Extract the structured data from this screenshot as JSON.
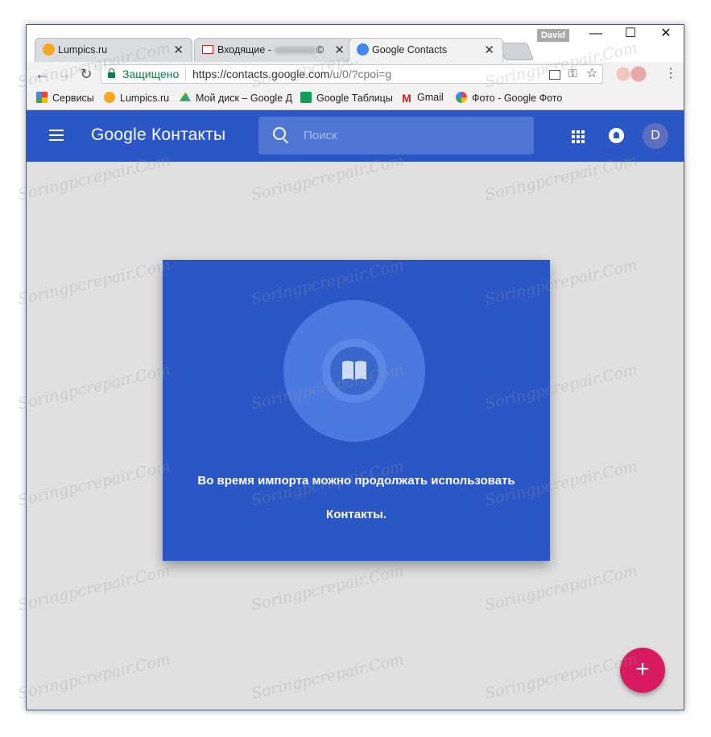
{
  "browser": {
    "profile_name": "David",
    "tabs": [
      {
        "title": "Lumpics.ru",
        "favicon": "orange-icon"
      },
      {
        "title": "Входящие -",
        "suffix": "©",
        "favicon": "gmail-icon"
      },
      {
        "title": "Google Contacts",
        "favicon": "contacts-icon"
      }
    ],
    "tab_close": "✕",
    "window_controls": {
      "minimize": "—",
      "maximize": "☐",
      "close": "✕"
    },
    "nav": {
      "back": "←",
      "forward": "→",
      "reload": "↻"
    },
    "omnibox": {
      "secure_label": "Защищено",
      "url_host": "https://contacts.google.com",
      "url_path": "/u/0/?cpoi=g"
    },
    "omnibox_icons": {
      "key": "⚿",
      "star": "☆"
    },
    "menu": "⋮",
    "bookmarks": [
      {
        "label": "Сервисы",
        "icon": "apps-grid-icon"
      },
      {
        "label": "Lumpics.ru",
        "icon": "orange-icon"
      },
      {
        "label": "Мой диск – Google Д",
        "icon": "drive-icon"
      },
      {
        "label": "Google Таблицы",
        "icon": "sheets-icon"
      },
      {
        "label": "Gmail",
        "icon": "gmail-icon"
      },
      {
        "label": "Фото - Google Фото",
        "icon": "photos-icon"
      }
    ]
  },
  "app": {
    "brand": "Google Контакты",
    "search_placeholder": "Поиск",
    "avatar_letter": "D",
    "accent_color": "#2a56c6",
    "fab_color": "#d81b60",
    "fab_label": "+"
  },
  "dialog": {
    "message_line1": "Во время импорта можно продолжать использовать",
    "message_line2": "Контакты."
  },
  "watermark": "Soringpcrepair.Com"
}
